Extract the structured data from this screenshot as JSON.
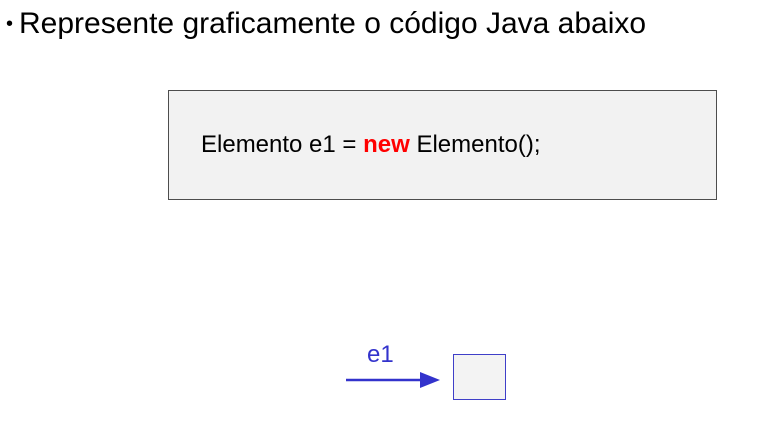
{
  "slide": {
    "bullet": "•",
    "heading": "Represente graficamente o código Java abaixo"
  },
  "code": {
    "before_keyword": "Elemento e1 = ",
    "keyword": "new",
    "after_keyword": " Elemento();",
    "keyword_color": "#ff0000"
  },
  "diagram": {
    "variable_label": "e1",
    "arrow_color": "#3333cc",
    "object_fill": "#f3f3f3"
  }
}
